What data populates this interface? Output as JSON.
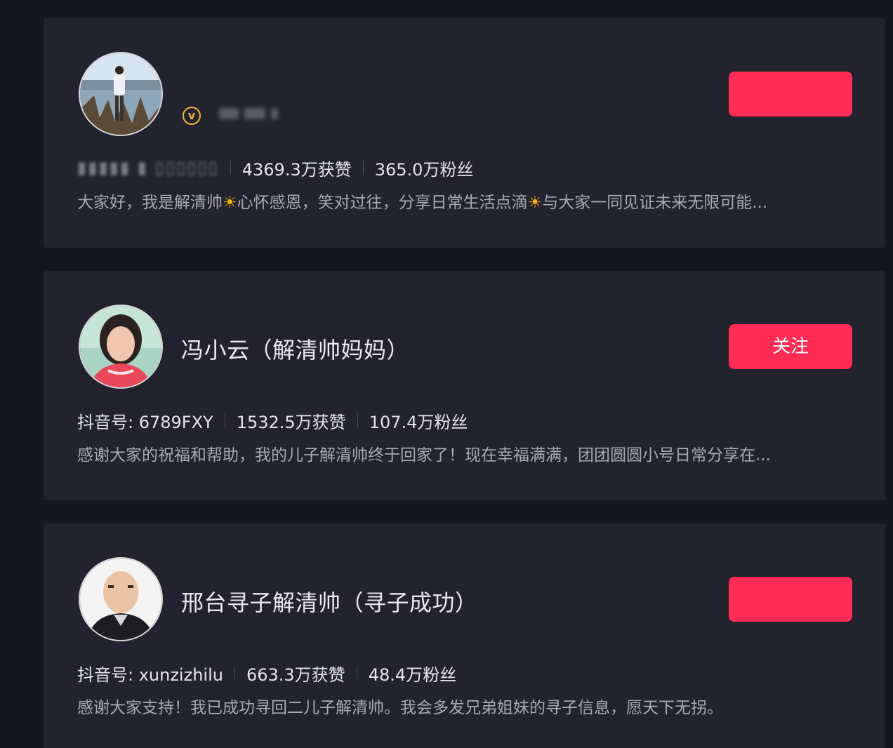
{
  "colors": {
    "background": "#16161e",
    "card": "#22232e",
    "accent": "#fe2c55",
    "verified": "#f2b53c",
    "text_primary": "#e9e9ee",
    "text_secondary": "#a9a9b2"
  },
  "results": [
    {
      "name": "",
      "verified_icon": "v",
      "follow_label": "",
      "douyin_id_label": "",
      "likes": "4369.3万获赞",
      "fans": "365.0万粉丝",
      "bio_parts": [
        "大家好，我是解清帅",
        "☀",
        "心怀感恩，笑对过往，分享日常生活点滴",
        "☀",
        "与大家一同见证未来无限可能..."
      ]
    },
    {
      "name": "冯小云（解清帅妈妈）",
      "follow_label": "关注",
      "douyin_id_label": "抖音号: 6789FXY",
      "likes": "1532.5万获赞",
      "fans": "107.4万粉丝",
      "bio": "感谢大家的祝福和帮助，我的儿子解清帅终于回家了！现在幸福满满，团团圆圆小号日常分享在..."
    },
    {
      "name": "邢台寻子解清帅（寻子成功）",
      "follow_label": "",
      "douyin_id_label": "抖音号: xunzizhilu",
      "likes": "663.3万获赞",
      "fans": "48.4万粉丝",
      "bio": "感谢大家支持！我已成功寻回二儿子解清帅。我会多发兄弟姐妹的寻子信息，愿天下无拐。"
    }
  ]
}
